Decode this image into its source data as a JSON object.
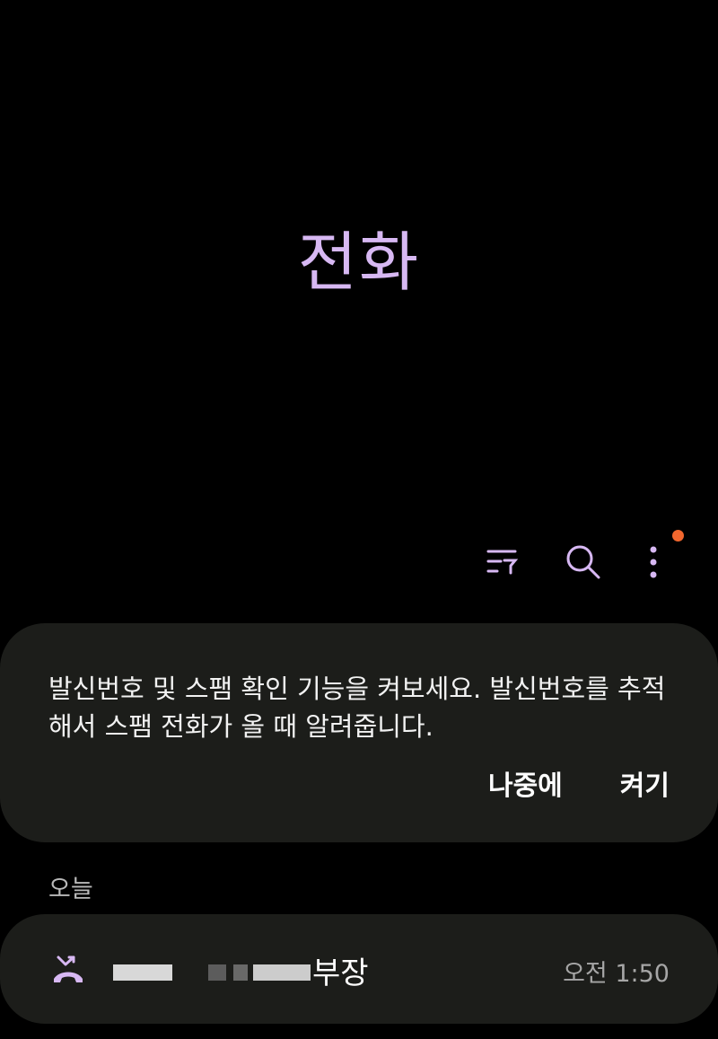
{
  "app": {
    "title": "전화"
  },
  "toolbar": {
    "filter_icon": "filter-list-icon",
    "search_icon": "search-icon",
    "more_icon": "more-vertical-icon",
    "notification_dot_color": "#f2672e",
    "accent_color": "#d7b8f3"
  },
  "banner": {
    "message": "발신번호 및 스팸 확인 기능을 켜보세요. 발신번호를 추적해서 스팸 전화가 올 때 알려줍니다.",
    "later_label": "나중에",
    "enable_label": "켜기"
  },
  "recents": {
    "section_label": "오늘",
    "calls": [
      {
        "name_suffix": "부장",
        "time": "오전 1:50",
        "type_icon": "missed-call-icon"
      }
    ]
  }
}
